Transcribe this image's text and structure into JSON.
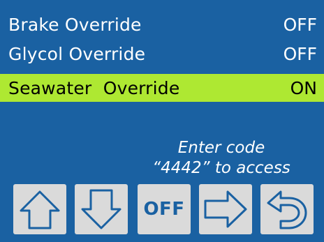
{
  "overrides": [
    {
      "label": "Brake Override",
      "value": "OFF"
    },
    {
      "label": "Glycol Override",
      "value": "OFF"
    },
    {
      "label": "Seawater  Override",
      "value": "ON"
    }
  ],
  "prompt": {
    "line1": "Enter code",
    "line2": "“4442” to access"
  },
  "buttons": {
    "up_icon": "arrow-up-icon",
    "down_icon": "arrow-down-icon",
    "off_label": "OFF",
    "right_icon": "arrow-right-icon",
    "back_icon": "return-arrow-icon"
  },
  "colors": {
    "background": "#1a61a2",
    "highlight": "#aee832",
    "button": "#dadada"
  }
}
